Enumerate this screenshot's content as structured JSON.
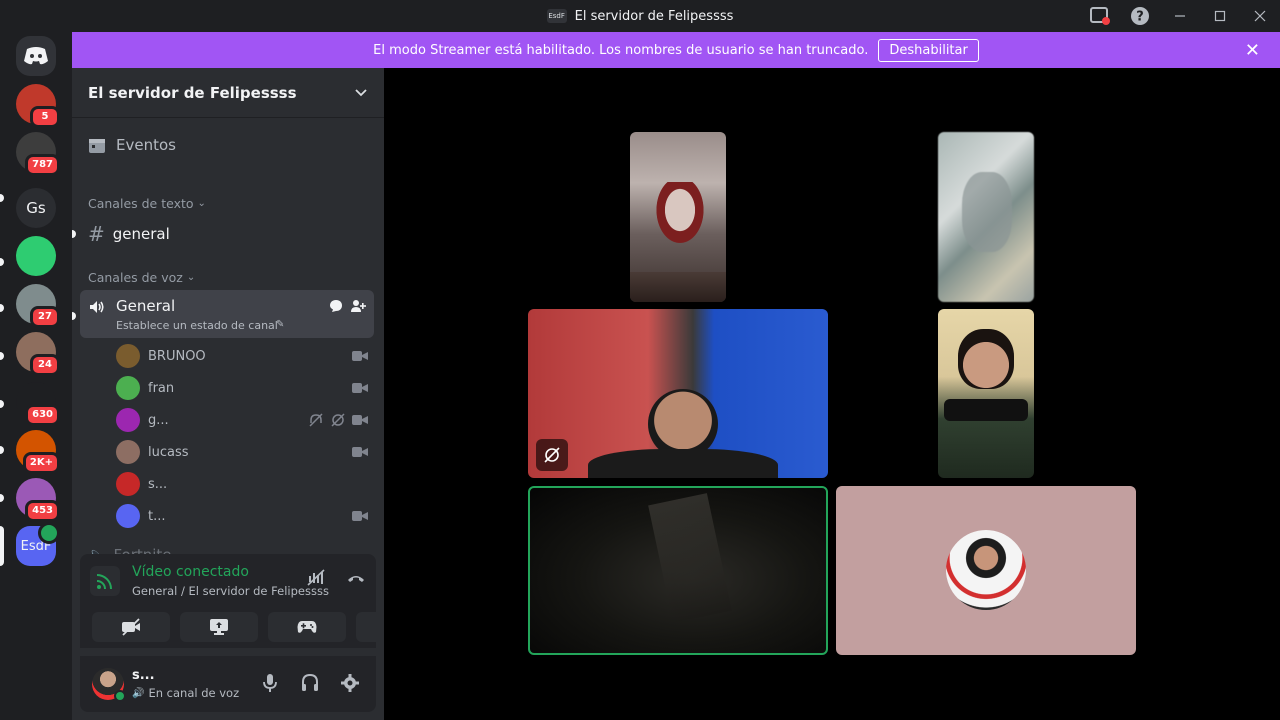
{
  "window": {
    "title": "El servidor de Felipessss",
    "mini_label": "EsdF"
  },
  "banner": {
    "text": "El modo Streamer está habilitado. Los nombres de usuario se han truncado.",
    "button": "Deshabilitar"
  },
  "guilds": {
    "items": [
      {
        "label": "",
        "badge": "5",
        "color": "#c0392b"
      },
      {
        "label": "",
        "badge": "787",
        "color": "#3d3d3d"
      },
      {
        "label": "Gs",
        "badge": "",
        "color": "#2b2d31"
      },
      {
        "label": "",
        "badge": "",
        "color": "#2ecc71"
      },
      {
        "label": "",
        "badge": "27",
        "color": "#7f8c8d"
      },
      {
        "label": "",
        "badge": "24",
        "color": "#8e6e5e"
      },
      {
        "label": "",
        "badge": "630",
        "color": "#1e1f22"
      },
      {
        "label": "",
        "badge": "2K+",
        "color": "#d35400"
      },
      {
        "label": "",
        "badge": "453",
        "color": "#9b59b6"
      },
      {
        "label": "EsdF",
        "badge": "",
        "color": "#5865f2"
      }
    ]
  },
  "sidebar": {
    "server_name": "El servidor de Felipessss",
    "events": "Eventos",
    "text_category": "Canales de texto",
    "text_channel": "general",
    "voice_category": "Canales de voz",
    "voice_channel": "General",
    "voice_status": "Establece un estado de canal",
    "partial_channel": "Fortnite",
    "users": [
      {
        "name": "BRUNOO",
        "color": "#7a5c2e"
      },
      {
        "name": "fran",
        "color": "#4caf50"
      },
      {
        "name": "g...",
        "color": "#9c27b0"
      },
      {
        "name": "lucass",
        "color": "#8d6e63"
      },
      {
        "name": "s...",
        "color": "#c62828"
      },
      {
        "name": "t...",
        "color": "#5865f2"
      }
    ]
  },
  "voice_panel": {
    "title": "Vídeo conectado",
    "subtitle": "General / El servidor de Felipessss"
  },
  "user_panel": {
    "name": "s...",
    "status": "En canal de voz"
  },
  "colors": {
    "accent": "#5865f2",
    "banner": "#a155f4",
    "online": "#23a55a",
    "speaking": "#23a55a"
  }
}
